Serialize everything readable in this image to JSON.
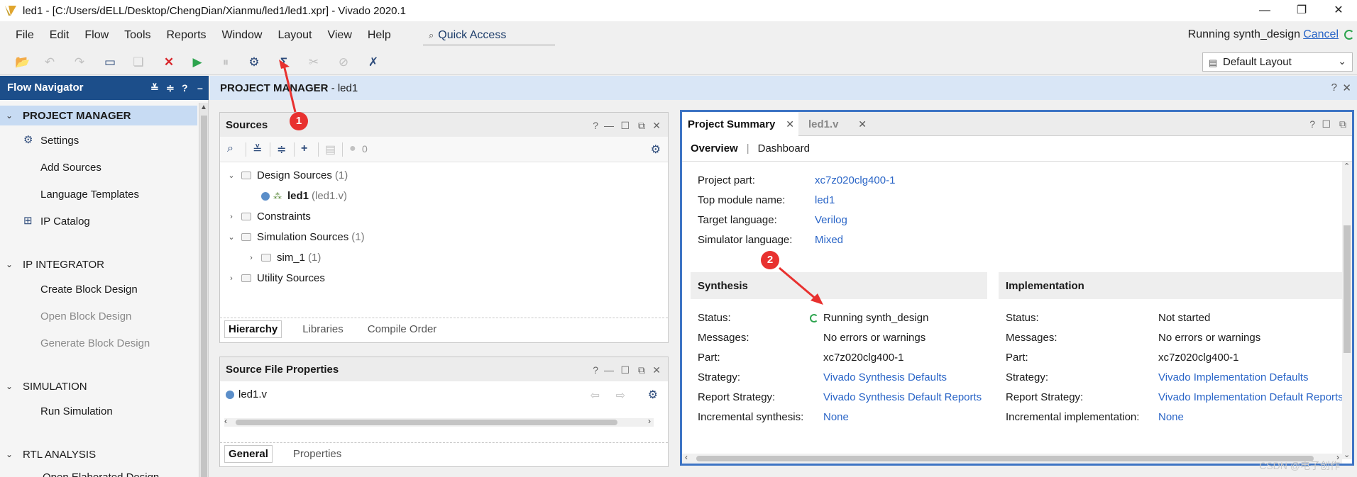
{
  "window": {
    "title": "led1 - [C:/Users/dELL/Desktop/ChengDian/Xianmu/led1/led1.xpr] - Vivado 2020.1",
    "controls": [
      "—",
      "❐",
      "✕"
    ]
  },
  "menu": {
    "items": [
      "File",
      "Edit",
      "Flow",
      "Tools",
      "Reports",
      "Window",
      "Layout",
      "View",
      "Help"
    ],
    "quick_access": "Quick Access",
    "run_status": "Running synth_design",
    "cancel": "Cancel"
  },
  "toolbar": {
    "layout_select": "Default Layout"
  },
  "flow_navigator": {
    "title": "Flow Navigator",
    "sections": [
      {
        "label": "PROJECT MANAGER",
        "items": [
          "Settings",
          "Add Sources",
          "Language Templates",
          "IP Catalog"
        ]
      },
      {
        "label": "IP INTEGRATOR",
        "items": [
          "Create Block Design",
          "Open Block Design",
          "Generate Block Design"
        ]
      },
      {
        "label": "SIMULATION",
        "items": [
          "Run Simulation"
        ]
      },
      {
        "label": "RTL ANALYSIS",
        "items": [
          "Open Elaborated Design"
        ]
      }
    ]
  },
  "project_manager": {
    "title": "PROJECT MANAGER",
    "subtitle": "- led1"
  },
  "sources": {
    "title": "Sources",
    "count": "0",
    "tree": [
      {
        "label": "Design Sources",
        "count": "(1)"
      },
      {
        "label": "led1",
        "count": "(led1.v)"
      },
      {
        "label": "Constraints",
        "count": ""
      },
      {
        "label": "Simulation Sources",
        "count": "(1)"
      },
      {
        "label": "sim_1",
        "count": "(1)"
      },
      {
        "label": "Utility Sources",
        "count": ""
      }
    ],
    "tabs": [
      "Hierarchy",
      "Libraries",
      "Compile Order"
    ]
  },
  "source_file_properties": {
    "title": "Source File Properties",
    "file": "led1.v",
    "tabs": [
      "General",
      "Properties"
    ]
  },
  "summary": {
    "tabs": [
      "Project Summary",
      "led1.v"
    ],
    "subtabs": [
      "Overview",
      "Dashboard"
    ],
    "info": [
      {
        "key": "Project part:",
        "value": "xc7z020clg400-1"
      },
      {
        "key": "Top module name:",
        "value": "led1"
      },
      {
        "key": "Target language:",
        "value": "Verilog"
      },
      {
        "key": "Simulator language:",
        "value": "Mixed"
      }
    ],
    "synthesis": {
      "title": "Synthesis",
      "rows": [
        {
          "key": "Status:",
          "value": "Running synth_design"
        },
        {
          "key": "Messages:",
          "value": "No errors or warnings"
        },
        {
          "key": "Part:",
          "value": "xc7z020clg400-1"
        },
        {
          "key": "Strategy:",
          "value": "Vivado Synthesis Defaults"
        },
        {
          "key": "Report Strategy:",
          "value": "Vivado Synthesis Default Reports"
        },
        {
          "key": "Incremental synthesis:",
          "value": "None"
        }
      ]
    },
    "implementation": {
      "title": "Implementation",
      "rows": [
        {
          "key": "Status:",
          "value": "Not started"
        },
        {
          "key": "Messages:",
          "value": "No errors or warnings"
        },
        {
          "key": "Part:",
          "value": "xc7z020clg400-1"
        },
        {
          "key": "Strategy:",
          "value": "Vivado Implementation Defaults"
        },
        {
          "key": "Report Strategy:",
          "value": "Vivado Implementation Default Reports"
        },
        {
          "key": "Incremental implementation:",
          "value": "None"
        }
      ]
    }
  },
  "annotations": {
    "badge1": "1",
    "badge2": "2"
  },
  "watermark": "CSDN @电子创作"
}
